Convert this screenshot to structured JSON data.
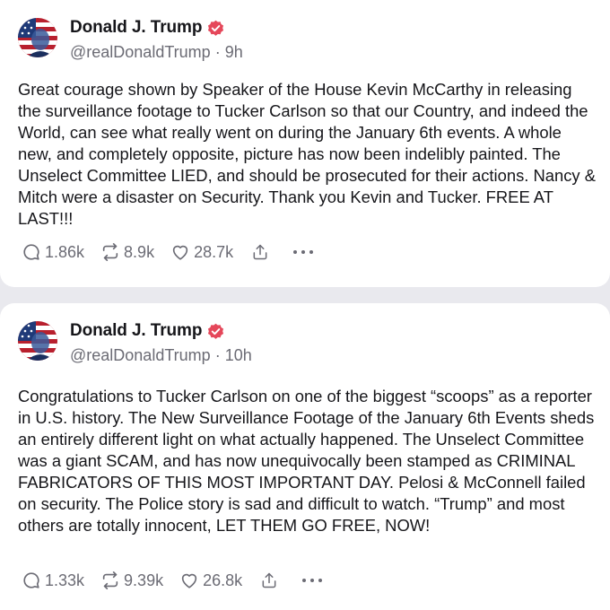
{
  "colors": {
    "background": "#e9e9ee",
    "card": "#ffffff",
    "text": "#16161a",
    "muted": "#6b6b74",
    "verified_badge": "#e5475a"
  },
  "posts": [
    {
      "author": "Donald J. Trump",
      "handle": "@realDonaldTrump",
      "separator": "·",
      "time": "9h",
      "text": "Great courage shown by Speaker of the House Kevin McCarthy in releasing the surveillance footage to Tucker Carlson so that our Country, and indeed the World, can see what really went on during the January 6th events. A whole new, and completely opposite, picture has now been indelibly painted. The Unselect Committee LIED, and should be prosecuted for their actions. Nancy & Mitch were a disaster on Security. Thank you Kevin and Tucker. FREE AT LAST!!!",
      "replies": "1.86k",
      "retruths": "8.9k",
      "likes": "28.7k",
      "avatar_icon": "avatar-flag-portrait",
      "icons": [
        "reply-icon",
        "retruth-icon",
        "heart-icon",
        "share-icon",
        "more-icon"
      ]
    },
    {
      "author": "Donald J. Trump",
      "handle": "@realDonaldTrump",
      "separator": "·",
      "time": "10h",
      "text": "Congratulations to Tucker Carlson on one of the biggest “scoops” as a reporter in U.S. history. The New Surveillance Footage of the January 6th Events sheds an entirely different light on what actually happened. The Unselect Committee was a giant SCAM, and has now unequivocally been stamped as CRIMINAL FABRICATORS OF THIS MOST IMPORTANT DAY. Pelosi & McConnell failed on security. The Police story is sad and difficult to watch. “Trump” and most others are totally innocent, LET THEM GO FREE, NOW!",
      "replies": "1.33k",
      "retruths": "9.39k",
      "likes": "26.8k",
      "avatar_icon": "avatar-flag-portrait",
      "icons": [
        "reply-icon",
        "retruth-icon",
        "heart-icon",
        "share-icon",
        "more-icon"
      ]
    }
  ]
}
